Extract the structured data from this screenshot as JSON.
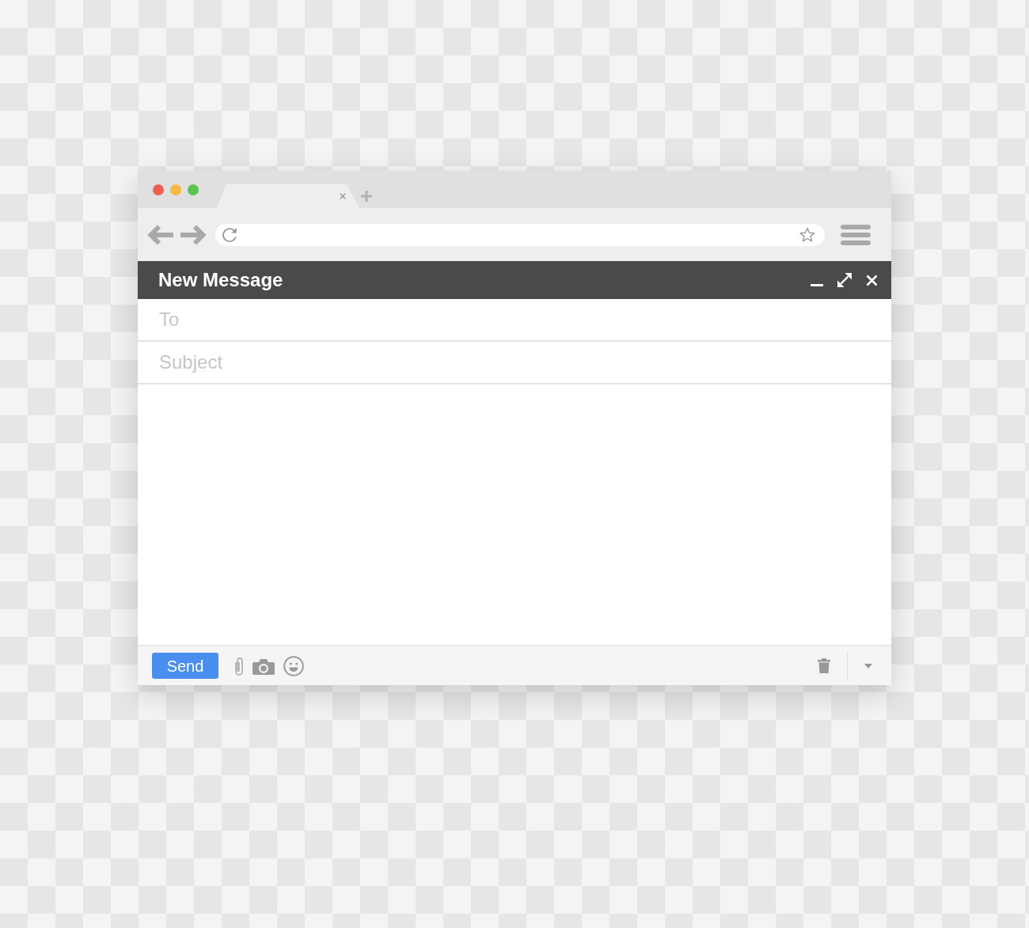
{
  "window": {
    "controls": [
      {
        "color": "#ee5f52"
      },
      {
        "color": "#f5b941"
      },
      {
        "color": "#5cc252"
      }
    ]
  },
  "compose": {
    "title": "New Message",
    "fields": [
      {
        "placeholder": "To"
      },
      {
        "placeholder": "Subject"
      }
    ],
    "send_label": "Send"
  }
}
